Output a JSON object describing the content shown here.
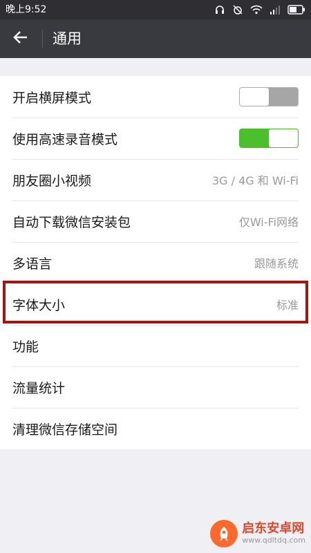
{
  "status_bar": {
    "time": "晚上9:52"
  },
  "header": {
    "title": "通用"
  },
  "settings": [
    {
      "label": "开启横屏模式",
      "type": "toggle",
      "enabled": false
    },
    {
      "label": "使用高速录音模式",
      "type": "toggle",
      "enabled": true
    },
    {
      "label": "朋友圈小视频",
      "value": "3G / 4G 和 Wi-Fi"
    },
    {
      "label": "自动下载微信安装包",
      "value": "仅Wi-Fi网络"
    },
    {
      "label": "多语言",
      "value": "跟随系统"
    },
    {
      "label": "字体大小",
      "value": "标准"
    },
    {
      "label": "功能"
    },
    {
      "label": "流量统计"
    },
    {
      "label": "清理微信存储空间"
    }
  ],
  "watermark": {
    "title": "启东安卓网",
    "url": "www.qdltdq.com"
  },
  "colors": {
    "status_bar_bg": "#2e2e33",
    "header_bg": "#393a3f",
    "page_bg": "#efeff4",
    "toggle_on": "#4cbf2c",
    "toggle_off": "#a6a6a6",
    "highlight": "#a31515"
  }
}
